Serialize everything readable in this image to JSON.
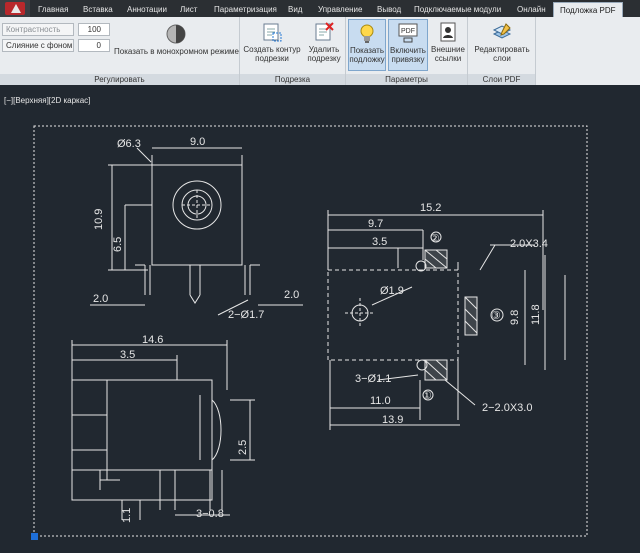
{
  "tabs": [
    "Главная",
    "Вставка",
    "Аннотации",
    "Лист",
    "Параметризация",
    "Вид",
    "Управление",
    "Вывод",
    "Подключаемые модули",
    "Онлайн",
    "Подложка PDF"
  ],
  "adjust": {
    "contrast_label": "Контрастность",
    "contrast_value": "100",
    "fade_label": "Слияние с фоном",
    "fade_value": "0",
    "mono_label": "Показать в монохромном режиме",
    "title": "Регулировать"
  },
  "clip": {
    "create_label_1": "Создать контур",
    "create_label_2": "подрезки",
    "remove_label_1": "Удалить",
    "remove_label_2": "подрезку",
    "title": "Подрезка"
  },
  "options": {
    "show_label_1": "Показать",
    "show_label_2": "подложку",
    "snap_label_1": "Включить",
    "snap_label_2": "привязку",
    "ext_label_1": "Внешние",
    "ext_label_2": "ссылки",
    "title": "Параметры",
    "pdf_badge": "PDF"
  },
  "layers": {
    "edit_label_1": "Редактировать",
    "edit_label_2": "слои",
    "title": "Слои PDF"
  },
  "viewport": "[−][Верхняя][2D каркас]",
  "dims": {
    "d1": "Ø6.3",
    "d2": "9.0",
    "d3": "10.9",
    "d4": "6.5",
    "d5": "2.0",
    "d6": "2−Ø1.7",
    "d7": "2.0",
    "d8": "15.2",
    "d9": "9.7",
    "d10": "3.5",
    "d11": "2.0X3.4",
    "d12": "Ø1.9",
    "d13": "9.8",
    "d14": "11.8",
    "d15": "3−Ø1.1",
    "d16": "11.0",
    "d17": "13.9",
    "d18": "2−2.0X3.0",
    "d19": "14.6",
    "d20": "3.5",
    "d21": "2.5",
    "d22": "1.1",
    "d23": "3−0.8",
    "c1": "②",
    "c2": "③",
    "c3": "①"
  },
  "colors": {
    "canvas": "#212830",
    "ribbon": "#e9ecef",
    "drawing": "#e6e6e6",
    "grip": "#1e6fd9",
    "selected": "#c8dcf0"
  }
}
